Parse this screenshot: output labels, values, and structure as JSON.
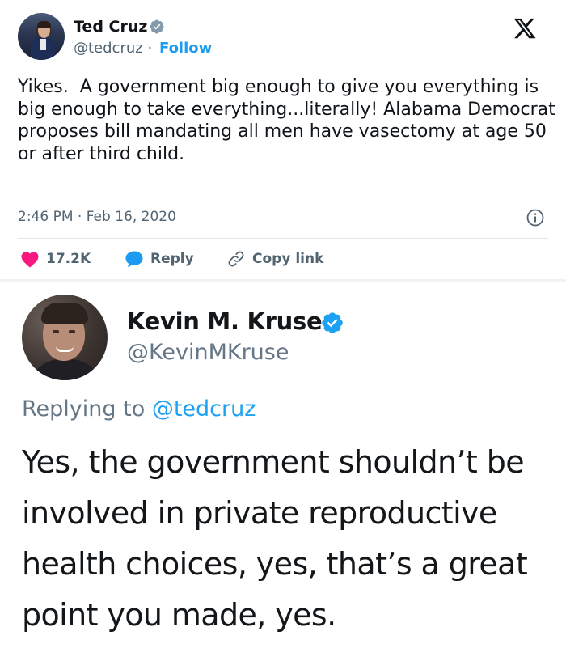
{
  "tweet": {
    "author_name": "Ted Cruz",
    "author_handle": "@tedcruz",
    "handle_separator": "·",
    "follow_label": "Follow",
    "text": "Yikes.  A government big enough to give you everything is big enough to take everything...literally! Alabama Democrat proposes bill mandating all men have vasectomy at age 50 or after third child.",
    "timestamp": "2:46 PM · Feb 16, 2020",
    "actions": {
      "like_count": "17.2K",
      "reply_label": "Reply",
      "copy_label": "Copy link"
    },
    "icons": {
      "logo": "x-logo-icon",
      "verified": "verified-badge-icon",
      "info": "info-icon",
      "like": "heart-icon",
      "reply": "speech-bubble-icon",
      "copy": "link-icon"
    },
    "colors": {
      "link_blue": "#1d9bf0",
      "like_red": "#f91880",
      "text": "#0f1419",
      "muted": "#536471"
    }
  },
  "reply": {
    "author_name": "Kevin M. Kruse",
    "author_handle": "@KevinMKruse",
    "replying_prefix": "Replying to",
    "replying_to": "@tedcruz",
    "text": "Yes, the government shouldn’t be involved in private reproductive health choices, yes, that’s a great point you made, yes.",
    "colors": {
      "mention_blue": "#1da1f2",
      "muted": "#657786"
    }
  }
}
